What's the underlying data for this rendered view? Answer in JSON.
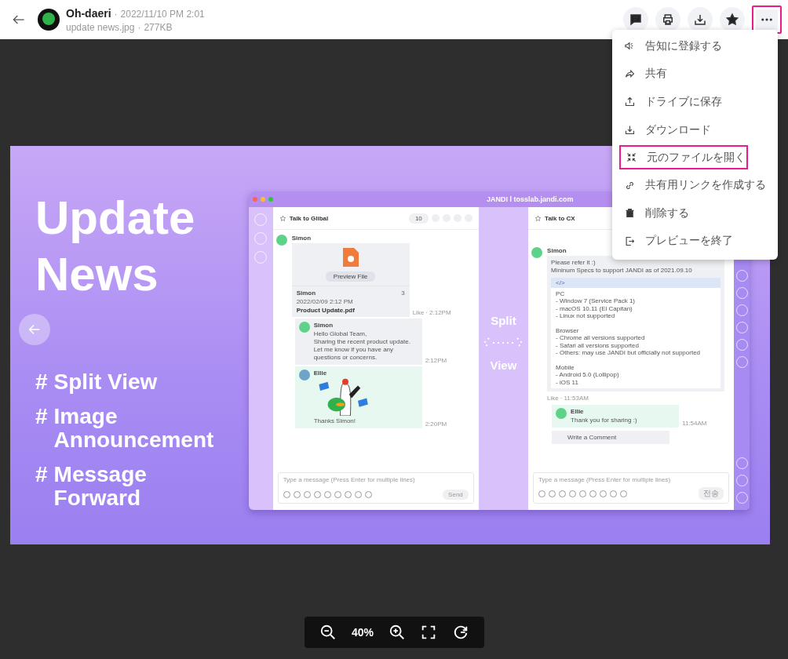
{
  "header": {
    "name": "Oh-daeri",
    "separator": "·",
    "date": "2022/11/10 PM 2:01",
    "file_name": "update news.jpg",
    "file_size": "277KB"
  },
  "actions": [
    {
      "kind": "comment",
      "highlighted": false
    },
    {
      "kind": "print",
      "highlighted": false
    },
    {
      "kind": "download",
      "highlighted": false
    },
    {
      "kind": "star",
      "highlighted": false
    },
    {
      "kind": "more",
      "highlighted": true
    }
  ],
  "menu": [
    {
      "kind": "announce",
      "label": "告知に登録する",
      "highlighted": false
    },
    {
      "kind": "share",
      "label": "共有",
      "highlighted": false
    },
    {
      "kind": "upload",
      "label": "ドライブに保存",
      "highlighted": false
    },
    {
      "kind": "download",
      "label": "ダウンロード",
      "highlighted": false
    },
    {
      "kind": "collapse",
      "label": "元のファイルを開く",
      "highlighted": true
    },
    {
      "kind": "link",
      "label": "共有用リンクを作成する",
      "highlighted": false
    },
    {
      "kind": "delete",
      "label": "削除する",
      "highlighted": false
    },
    {
      "kind": "exit",
      "label": "プレビューを終了",
      "highlighted": false
    }
  ],
  "image": {
    "headline": [
      "Update",
      "News"
    ],
    "features": [
      {
        "mark": "#",
        "lines": [
          "Split View"
        ]
      },
      {
        "mark": "#",
        "lines": [
          "Image",
          "Announcement"
        ]
      },
      {
        "mark": "#",
        "lines": [
          "Message",
          "Forward"
        ]
      }
    ],
    "window_title": "JANDI l tosslab.jandi.com",
    "split": {
      "top": "Split",
      "bottom": "View"
    },
    "left_chat": {
      "title": "Talk to Glibal",
      "member_count": "10",
      "file_post": {
        "author": "Simon",
        "preview": "Preview File",
        "card_author": "Simon",
        "comments": "3",
        "date": "2022/02/09 2:12 PM",
        "file": "Product Update.pdf",
        "like": "Like",
        "separator": "·",
        "time": "2:12PM"
      },
      "comment": {
        "author": "Simon",
        "text": "Hello Global Team,\nSharing the recent product update.\nLet me know if you have any\nquestions or concerns.",
        "time": "2:12PM"
      },
      "sticker_comment": {
        "author": "Ellie",
        "text": "Thanks Simon!",
        "time": "2:20PM"
      },
      "composer": {
        "placeholder": "Type a message (Press Enter for multiple lines)",
        "send": "Send"
      }
    },
    "right_chat": {
      "title": "Talk to CX",
      "post": {
        "author": "Simon",
        "intro": "Please refer it :)\nMininum Specs to support JANDI as of 2021.09.10",
        "code_tag": "</>",
        "code": "PC\n- Window 7 (Service Pack 1)\n- macOS 10.11 (El Capitan)\n- Linux not supported\n\nBrowser\n- Chrome all versions supported\n- Safari all versions supported\n- Others: may use JANDI but officially not supported\n\nMobile\n- Android 5.0 (Lollipop)\n- iOS 11",
        "like": "Like",
        "separator": "·",
        "time": "11:53AM"
      },
      "reply": {
        "author": "Ellie",
        "text": "Thank you for sharing :)",
        "time": "11:54AM"
      },
      "write_comment": "Write a Comment",
      "composer": {
        "placeholder": "Type a message (Press Enter for multiple lines)",
        "send": "전송"
      }
    }
  },
  "zoom": {
    "level": "40%"
  }
}
